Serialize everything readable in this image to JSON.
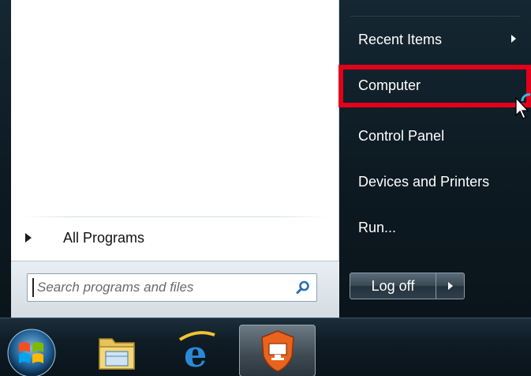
{
  "left_pane": {
    "all_programs_label": "All Programs",
    "search": {
      "placeholder": "Search programs and files",
      "value": ""
    }
  },
  "right_pane": {
    "items": [
      {
        "label": "Recent Items",
        "has_submenu": true
      },
      {
        "label": "Computer",
        "highlighted": true
      },
      {
        "label": "Control Panel"
      },
      {
        "label": "Devices and Printers"
      },
      {
        "label": "Run..."
      }
    ],
    "logoff_label": "Log off"
  },
  "taskbar": {
    "items": [
      {
        "icon": "windows-start-orb-icon"
      },
      {
        "icon": "windows-explorer-folder-icon"
      },
      {
        "icon": "internet-explorer-icon"
      },
      {
        "icon": "remote-desktop-app-icon",
        "active": true
      }
    ]
  },
  "colors": {
    "highlight_border": "#e3001b",
    "menu_background": "#0d1a22",
    "left_pane_background": "#ffffff"
  }
}
